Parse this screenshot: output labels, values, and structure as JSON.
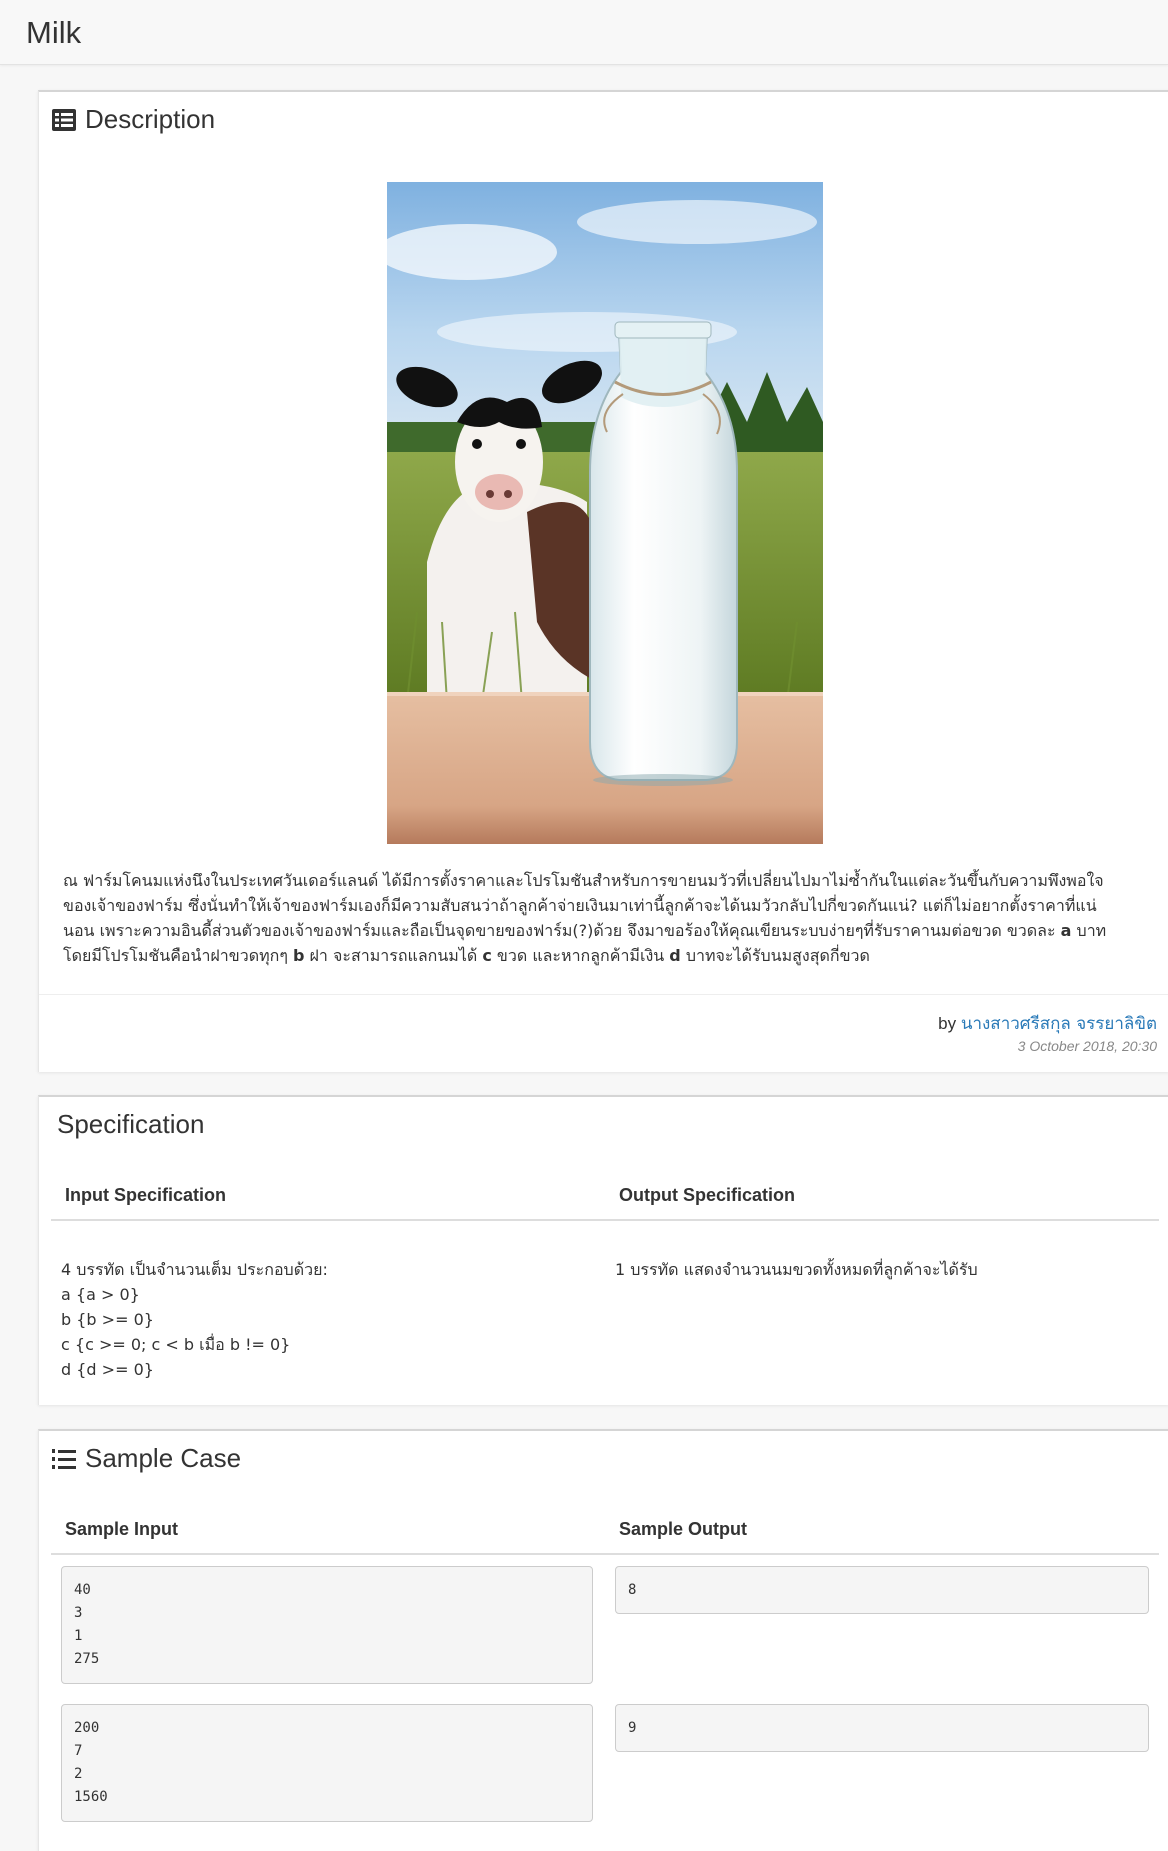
{
  "header": {
    "title": "Milk"
  },
  "description": {
    "title": "Description",
    "paragraph_lines": [
      "ณ ฟาร์มโคนมแห่งนึงในประเทศวันเดอร์แลนด์ ได้มีการตั้งราคาและโปรโมชันสำหรับการขายนมวัวที่เปลี่ยนไปมาไม่ซ้ำกันในแต่ละวันขึ้นกับความพึงพอใจ",
      "ของเจ้าของฟาร์ม ซึ่งนั่นทำให้เจ้าของฟาร์มเองก็มีความสับสนว่าถ้าลูกค้าจ่ายเงินมาเท่านี้ลูกค้าจะได้นมวัวกลับไปกี่ขวดกันแน่? แต่ก็ไม่อยากตั้งราคาที่แน่",
      "นอน เพราะความอินดี้ส่วนตัวของเจ้าของฟาร์มและถือเป็นจุดขายของฟาร์ม(?)ด้วย จึงมาขอร้องให้คุณเขียนระบบง่ายๆที่รับราคานมต่อขวด ขวดละ ",
      "โดยมีโปรโมชันคือนำฝาขวดทุกๆ "
    ],
    "line3_var": "a",
    "line3_tail": " บาท",
    "line4_var_b": "b",
    "line4_mid1": " ฝา จะสามารถแลกนมได้ ",
    "line4_var_c": "c",
    "line4_mid2": " ขวด และหากลูกค้ามีเงิน ",
    "line4_var_d": "d",
    "line4_tail": " บาทจะได้รับนมสูงสุดกี่ขวด",
    "author_prefix": "by ",
    "author_name": "นางสาวศรีสกุล จรรยาลิขิต",
    "timestamp": "3 October 2018, 20:30"
  },
  "specification": {
    "title": "Specification",
    "input_header": "Input Specification",
    "output_header": "Output Specification",
    "input_text": "4 บรรทัด เป็นจำนวนเต็ม ประกอบด้วย:\na {a > 0}\nb {b >= 0}\nc {c >= 0; c < b เมื่อ b != 0}\nd {d >= 0}",
    "output_text": "1 บรรทัด แสดงจำนวนนมขวดทั้งหมดที่ลูกค้าจะได้รับ"
  },
  "samples": {
    "title": "Sample Case",
    "input_header": "Sample Input",
    "output_header": "Sample Output",
    "cases": [
      {
        "input": "40\n3\n1\n275",
        "output": "8"
      },
      {
        "input": "200\n7\n2\n1560",
        "output": "9"
      }
    ]
  },
  "icons": {
    "description": "list-alt-icon",
    "sample": "list-ol-icon"
  }
}
